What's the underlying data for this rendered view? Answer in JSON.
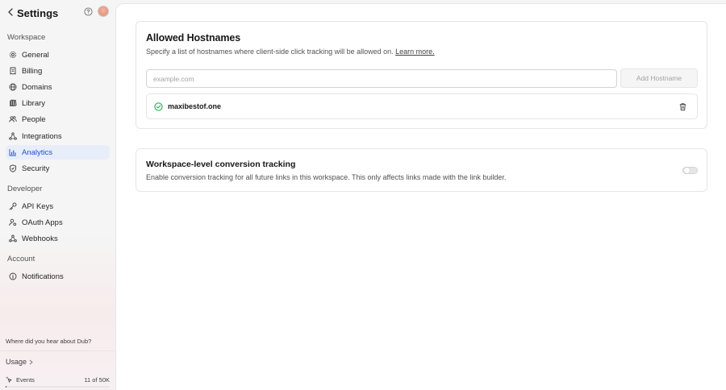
{
  "sidebar": {
    "title": "Settings",
    "sections": [
      {
        "label": "Workspace",
        "items": [
          {
            "label": "General",
            "icon": "gear-icon"
          },
          {
            "label": "Billing",
            "icon": "receipt-icon"
          },
          {
            "label": "Domains",
            "icon": "globe-icon"
          },
          {
            "label": "Library",
            "icon": "book-icon"
          },
          {
            "label": "People",
            "icon": "users-icon"
          },
          {
            "label": "Integrations",
            "icon": "connected-dots-icon"
          },
          {
            "label": "Analytics",
            "icon": "chart-icon",
            "active": true
          },
          {
            "label": "Security",
            "icon": "shield-icon"
          }
        ]
      },
      {
        "label": "Developer",
        "items": [
          {
            "label": "API Keys",
            "icon": "key-icon"
          },
          {
            "label": "OAuth Apps",
            "icon": "user-gear-icon"
          },
          {
            "label": "Webhooks",
            "icon": "webhook-icon"
          }
        ]
      },
      {
        "label": "Account",
        "items": [
          {
            "label": "Notifications",
            "icon": "info-icon"
          }
        ]
      }
    ],
    "promo": "Where did you hear about Dub?",
    "usage_label": "Usage",
    "events": {
      "label": "Events",
      "count": "11 of 50K",
      "progress": 0.0002
    }
  },
  "hostnames": {
    "title": "Allowed Hostnames",
    "description": "Specify a list of hostnames where client-side click tracking will be allowed on.",
    "learn_more": "Learn more.",
    "input_placeholder": "example.com",
    "add_button": "Add Hostname",
    "entries": [
      {
        "hostname": "maxibestof.one"
      }
    ]
  },
  "conversion": {
    "title": "Workspace-level conversion tracking",
    "description": "Enable conversion tracking for all future links in this workspace. This only affects links made with the link builder.",
    "enabled": false
  },
  "colors": {
    "accent": "#1d4ed8",
    "active_bg": "#e8eef9",
    "success": "#16a34a"
  }
}
